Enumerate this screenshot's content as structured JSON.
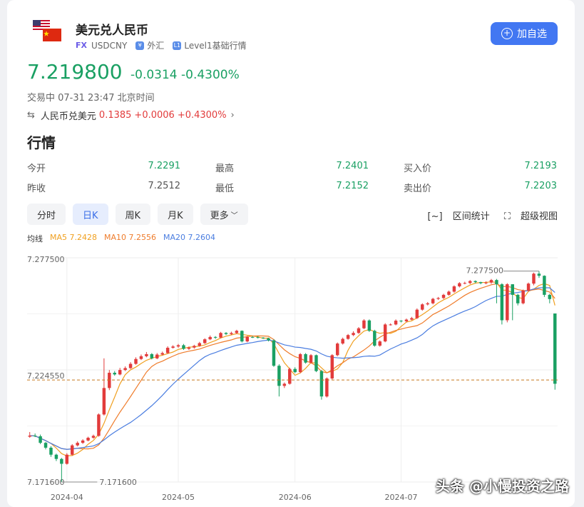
{
  "header": {
    "title": "美元兑人民币",
    "market_tag": "FX",
    "symbol": "USDCNY",
    "category": "外汇",
    "level": "Level1基础行情",
    "add_button": "加自选"
  },
  "quote": {
    "price": "7.219800",
    "change": "-0.0314",
    "change_pct": "-0.4300%",
    "status_time": "交易中 07-31 23:47 北京时间"
  },
  "reverse": {
    "label": "人民币兑美元",
    "price": "0.1385",
    "change": "+0.0006",
    "change_pct": "+0.4300%"
  },
  "section_title": "行情",
  "stats": {
    "open_label": "今开",
    "open": "7.2291",
    "high_label": "最高",
    "high": "7.2401",
    "bid_label": "买入价",
    "bid": "7.2193",
    "prev_label": "昨收",
    "prev": "7.2512",
    "low_label": "最低",
    "low": "7.2152",
    "ask_label": "卖出价",
    "ask": "7.2203"
  },
  "tabs": [
    "分时",
    "日K",
    "周K",
    "月K",
    "更多"
  ],
  "active_tab": 1,
  "tools": {
    "range": "区间统计",
    "super": "超级视图"
  },
  "ma": {
    "label": "均线",
    "ma5": "MA5 7.2428",
    "ma10": "MA10 7.2556",
    "ma20": "MA20 7.2604"
  },
  "colors": {
    "up": "#e23b3b",
    "down": "#1aa063",
    "ma5": "#f0a020",
    "ma10": "#ef7c2b",
    "ma20": "#4a7de0",
    "accent": "#4277f2"
  },
  "watermark": "头条 @小慢投资之路",
  "chart_data": {
    "type": "candlestick",
    "y_tick_labels": [
      "7.277500",
      "7.224550",
      "7.171600"
    ],
    "ylim": [
      7.1716,
      7.2775
    ],
    "max_label": "7.277500",
    "min_label": "7.171600",
    "ref_line": 7.2198,
    "x_tick_labels": [
      "2024-04",
      "2024-05",
      "2024-06",
      "2024-07"
    ],
    "closes": [
      7.1935,
      7.1932,
      7.1901,
      7.1878,
      7.1845,
      7.1825,
      7.1802,
      7.1845,
      7.1889,
      7.1901,
      7.1912,
      7.1925,
      7.1934,
      7.2035,
      7.216,
      7.2232,
      7.2224,
      7.2245,
      7.2254,
      7.2274,
      7.2297,
      7.231,
      7.232,
      7.23,
      7.2318,
      7.2325,
      7.235,
      7.2356,
      7.2362,
      7.2345,
      7.2351,
      7.2359,
      7.2372,
      7.239,
      7.2401,
      7.2398,
      7.242,
      7.2415,
      7.242,
      7.243,
      7.238,
      7.2401,
      7.24,
      7.2398,
      7.2395,
      7.2385,
      7.2265,
      7.217,
      7.218,
      7.225,
      7.2235,
      7.232,
      7.228,
      7.2315,
      7.224,
      7.212,
      7.2205,
      7.2315,
      7.237,
      7.2392,
      7.241,
      7.242,
      7.2442,
      7.2479,
      7.243,
      7.236,
      7.238,
      7.246,
      7.246,
      7.2478,
      7.2475,
      7.2483,
      7.249,
      7.253,
      7.2555,
      7.256,
      7.2581,
      7.2585,
      7.26,
      7.2615,
      7.264,
      7.2655,
      7.2656,
      7.2665,
      7.266,
      7.2655,
      7.2658,
      7.267,
      7.265,
      7.248,
      7.265,
      7.26,
      7.256,
      7.262,
      7.2653,
      7.27,
      7.269,
      7.26,
      7.258,
      7.218
    ],
    "opens": [
      7.193,
      7.1935,
      7.1932,
      7.1901,
      7.1878,
      7.1845,
      7.1825,
      7.1802,
      7.1845,
      7.1889,
      7.1901,
      7.1912,
      7.1925,
      7.1934,
      7.2035,
      7.216,
      7.2232,
      7.2224,
      7.2245,
      7.2254,
      7.2274,
      7.2297,
      7.231,
      7.232,
      7.23,
      7.2318,
      7.2325,
      7.235,
      7.2356,
      7.2362,
      7.2345,
      7.2351,
      7.2359,
      7.2372,
      7.239,
      7.2401,
      7.2398,
      7.242,
      7.2415,
      7.242,
      7.243,
      7.238,
      7.2401,
      7.24,
      7.2398,
      7.2395,
      7.2385,
      7.2265,
      7.217,
      7.218,
      7.225,
      7.2235,
      7.232,
      7.228,
      7.2315,
      7.224,
      7.212,
      7.2205,
      7.2315,
      7.237,
      7.2392,
      7.241,
      7.242,
      7.2442,
      7.2479,
      7.243,
      7.236,
      7.238,
      7.246,
      7.246,
      7.2478,
      7.2475,
      7.2483,
      7.249,
      7.253,
      7.2555,
      7.256,
      7.2581,
      7.2585,
      7.26,
      7.2615,
      7.264,
      7.2655,
      7.2656,
      7.2665,
      7.266,
      7.2655,
      7.2658,
      7.267,
      7.265,
      7.248,
      7.265,
      7.26,
      7.256,
      7.262,
      7.2653,
      7.27,
      7.269,
      7.26,
      7.2512
    ],
    "highs": [
      7.1952,
      7.1945,
      7.194,
      7.1905,
      7.1885,
      7.185,
      7.183,
      7.1852,
      7.1895,
      7.1908,
      7.1918,
      7.193,
      7.194,
      7.204,
      7.23,
      7.2245,
      7.224,
      7.2255,
      7.2262,
      7.2282,
      7.2305,
      7.2318,
      7.233,
      7.2325,
      7.2325,
      7.2332,
      7.2357,
      7.2362,
      7.2368,
      7.2368,
      7.2356,
      7.2364,
      7.2378,
      7.2395,
      7.2408,
      7.2405,
      7.2425,
      7.2424,
      7.2426,
      7.2435,
      7.2432,
      7.2406,
      7.2405,
      7.2405,
      7.24,
      7.2398,
      7.239,
      7.2272,
      7.2186,
      7.2256,
      7.2258,
      7.2325,
      7.2325,
      7.232,
      7.2318,
      7.2245,
      7.221,
      7.232,
      7.2375,
      7.2398,
      7.2415,
      7.2428,
      7.2448,
      7.2485,
      7.2484,
      7.2435,
      7.2385,
      7.2466,
      7.2465,
      7.2484,
      7.248,
      7.2488,
      7.2496,
      7.2536,
      7.256,
      7.2566,
      7.2586,
      7.259,
      7.2605,
      7.262,
      7.2645,
      7.266,
      7.2662,
      7.267,
      7.2668,
      7.2662,
      7.2664,
      7.2675,
      7.2675,
      7.2655,
      7.2655,
      7.265,
      7.2605,
      7.2625,
      7.2658,
      7.2705,
      7.2712,
      7.2692,
      7.2605,
      7.2401
    ],
    "lows": [
      7.1925,
      7.1928,
      7.1895,
      7.187,
      7.1835,
      7.1815,
      7.1716,
      7.1798,
      7.184,
      7.1884,
      7.1896,
      7.1908,
      7.192,
      7.193,
      7.203,
      7.215,
      7.2218,
      7.222,
      7.224,
      7.225,
      7.227,
      7.2292,
      7.2305,
      7.2295,
      7.2296,
      7.2314,
      7.2322,
      7.2346,
      7.235,
      7.234,
      7.234,
      7.2346,
      7.2355,
      7.2368,
      7.2386,
      7.2392,
      7.2395,
      7.241,
      7.241,
      7.2415,
      7.2375,
      7.2376,
      7.2396,
      7.2394,
      7.2392,
      7.238,
      7.226,
      7.212,
      7.216,
      7.2176,
      7.223,
      7.223,
      7.2275,
      7.2275,
      7.2235,
      7.2105,
      7.2115,
      7.22,
      7.231,
      7.2365,
      7.2388,
      7.2405,
      7.2416,
      7.2438,
      7.2425,
      7.2355,
      7.2355,
      7.2376,
      7.2455,
      7.2456,
      7.247,
      7.247,
      7.248,
      7.2486,
      7.2525,
      7.255,
      7.2555,
      7.2576,
      7.258,
      7.2596,
      7.261,
      7.2635,
      7.265,
      7.265,
      7.2655,
      7.265,
      7.265,
      7.2652,
      7.256,
      7.246,
      7.247,
      7.248,
      7.255,
      7.2555,
      7.2615,
      7.2645,
      7.268,
      7.259,
      7.256,
      7.2152
    ]
  }
}
